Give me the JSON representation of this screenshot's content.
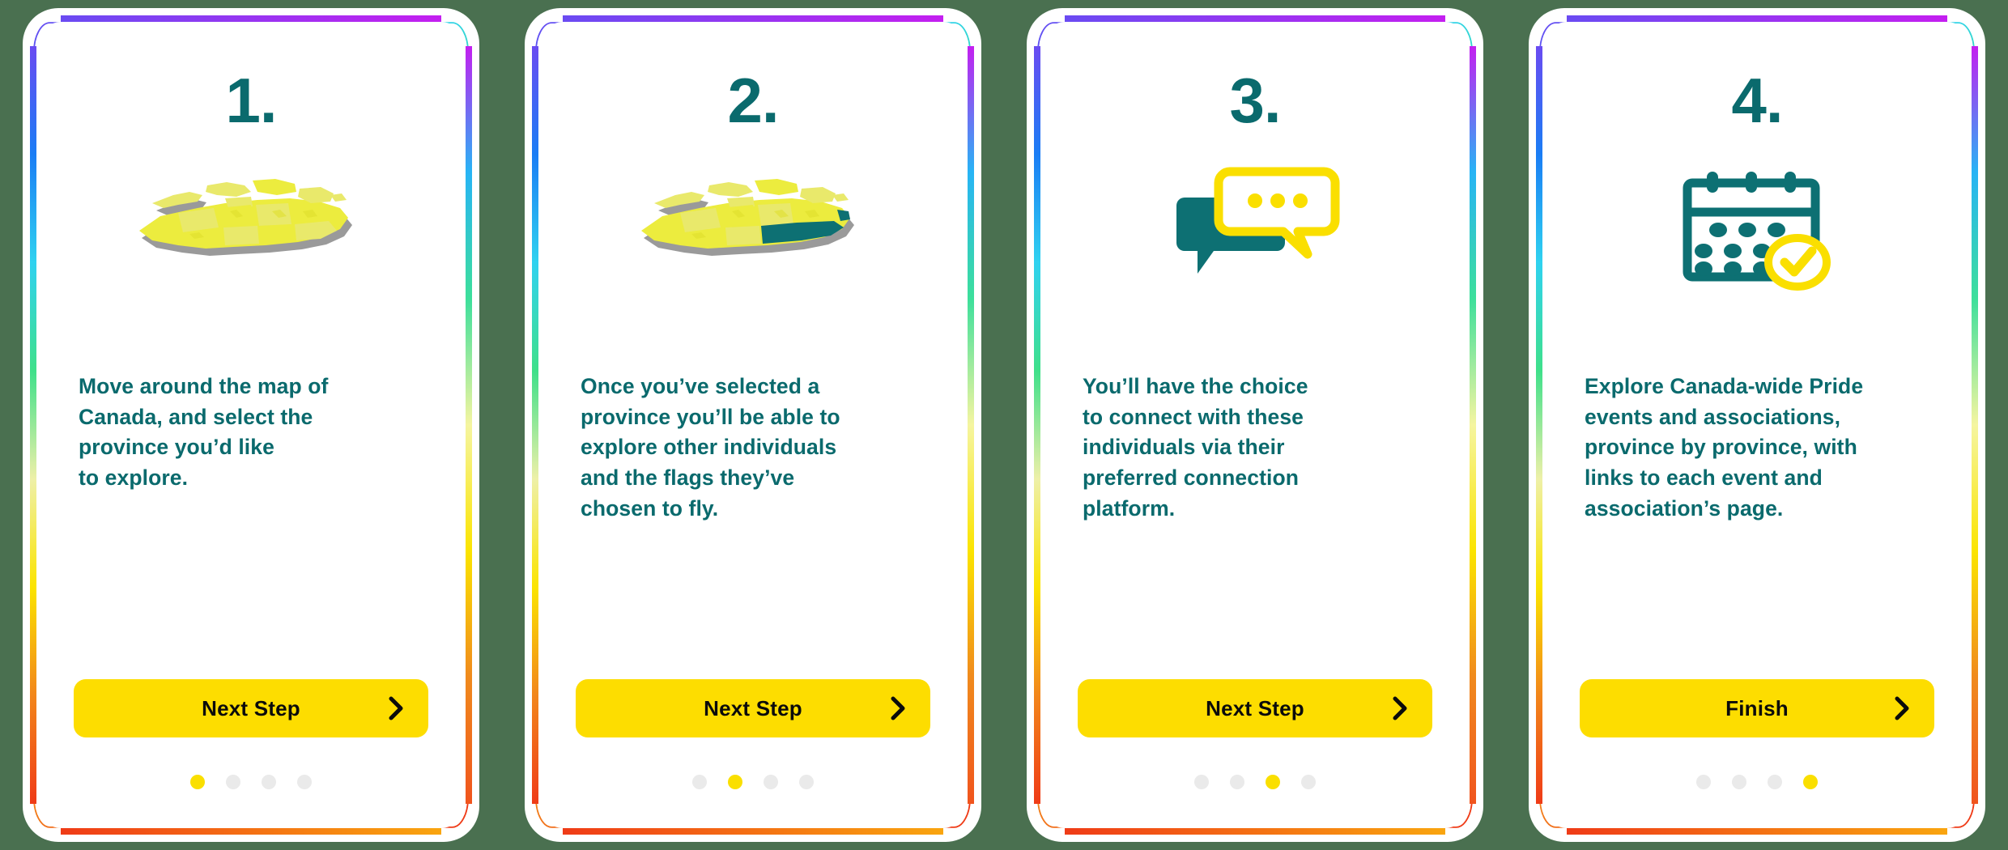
{
  "theme": {
    "background": "#4a7050",
    "card_bg": "#ffffff",
    "teal": "#0a6a6d",
    "yellow": "#fddd00",
    "dot_inactive": "#eaeaea",
    "dot_active": "#fadf00",
    "map_yellow": "#ecec3e",
    "map_yellow_light": "#e9e96b",
    "map_shadow": "#9a9a9a",
    "map_selected": "#0d7073",
    "gradient_top": [
      "#6a4bf2",
      "#c41ff0"
    ],
    "gradient_right": [
      "#c41ff0",
      "#27b4f5",
      "#3ddf9b",
      "#f5f5a0",
      "#fbe400",
      "#f08a1d",
      "#f0541d"
    ],
    "gradient_left": [
      "#6a4bf2",
      "#1a7df5",
      "#2fd2f0",
      "#3fe08a",
      "#eef0a8",
      "#fbe400",
      "#f2861b",
      "#ef3b17"
    ],
    "gradient_bottom": [
      "#ef3b17",
      "#f9a50f"
    ]
  },
  "cards": [
    {
      "number": "1.",
      "icon": "canada-map-icon",
      "body": "Move around the map of\nCanada, and select the\nprovince you’d like\nto explore.",
      "cta_label": "Next Step",
      "cta_icon": "chevron-right-icon",
      "active_dot": 0,
      "dots": 4
    },
    {
      "number": "2.",
      "icon": "canada-map-selected-icon",
      "body": "Once you’ve selected a\nprovince you’ll be able to\nexplore other individuals\nand the flags they’ve\nchosen to fly.",
      "cta_label": "Next Step",
      "cta_icon": "chevron-right-icon",
      "active_dot": 1,
      "dots": 4
    },
    {
      "number": "3.",
      "icon": "chat-bubbles-icon",
      "body": "You’ll have the choice\nto connect with these\nindividuals via their\npreferred connection\nplatform.",
      "cta_label": "Next Step",
      "cta_icon": "chevron-right-icon",
      "active_dot": 2,
      "dots": 4
    },
    {
      "number": "4.",
      "icon": "calendar-check-icon",
      "body": "Explore Canada-wide Pride\nevents and associations,\nprovince by province, with\nlinks to each event and\nassociation’s page.",
      "cta_label": "Finish",
      "cta_icon": "chevron-right-icon",
      "active_dot": 3,
      "dots": 4
    }
  ]
}
